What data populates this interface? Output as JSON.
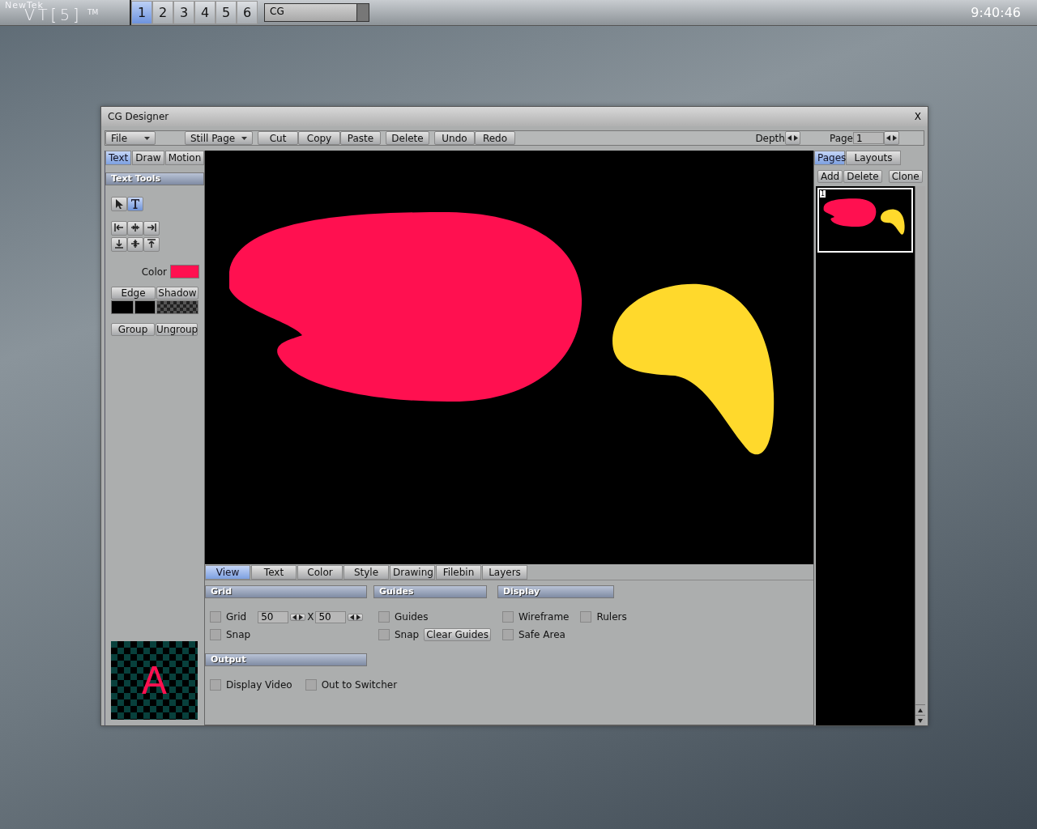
{
  "topbar": {
    "brand": "NewTek",
    "product": "VT[5]",
    "tm": "TM",
    "desktops": [
      {
        "label": "1",
        "selected": true
      },
      {
        "label": "2",
        "selected": false
      },
      {
        "label": "3",
        "selected": false
      },
      {
        "label": "4",
        "selected": false
      },
      {
        "label": "5",
        "selected": false
      },
      {
        "label": "6",
        "selected": false
      }
    ],
    "app_field": "CG",
    "clock": "9:40:46"
  },
  "window": {
    "title": "CG Designer",
    "close": "X"
  },
  "toolbar": {
    "file_menu": "File",
    "page_type": "Still Page",
    "buttons": [
      "Cut",
      "Copy",
      "Paste",
      "Delete",
      "Undo",
      "Redo"
    ],
    "depth_label": "Depth",
    "page_label": "Page",
    "page_value": "1"
  },
  "left_tabs": [
    {
      "label": "Text",
      "selected": true
    },
    {
      "label": "Draw",
      "selected": false
    },
    {
      "label": "Motion",
      "selected": false
    }
  ],
  "text_tools": {
    "header": "Text Tools",
    "tools": [
      {
        "kind": "pointer",
        "selected": false
      },
      {
        "kind": "text",
        "selected": true
      }
    ],
    "color_label": "Color",
    "color": "#ff1050",
    "edge": "Edge",
    "shadow": "Shadow",
    "group": "Group",
    "ungroup": "Ungroup",
    "preview_letter": "A"
  },
  "bottom_tabs": [
    {
      "label": "View",
      "selected": true
    },
    {
      "label": "Text",
      "selected": false
    },
    {
      "label": "Color",
      "selected": false
    },
    {
      "label": "Style",
      "selected": false
    },
    {
      "label": "Drawing",
      "selected": false
    },
    {
      "label": "Filebin",
      "selected": false
    },
    {
      "label": "Layers",
      "selected": false
    }
  ],
  "view": {
    "grid": {
      "title": "Grid",
      "grid": {
        "label": "Grid",
        "checked": false
      },
      "snap": {
        "label": "Snap",
        "checked": false
      },
      "x_value": "50",
      "times": "X",
      "y_value": "50"
    },
    "guides": {
      "title": "Guides",
      "guides": {
        "label": "Guides",
        "checked": false
      },
      "snap": {
        "label": "Snap",
        "checked": false
      },
      "clear": "Clear Guides"
    },
    "display": {
      "title": "Display",
      "wireframe": {
        "label": "Wireframe",
        "checked": false
      },
      "rulers": {
        "label": "Rulers",
        "checked": false
      },
      "safe_area": {
        "label": "Safe Area",
        "checked": false
      }
    },
    "output": {
      "title": "Output",
      "display_video": {
        "label": "Display Video",
        "checked": false
      },
      "out_to_switcher": {
        "label": "Out to Switcher",
        "checked": false
      }
    }
  },
  "right": {
    "tabs": [
      {
        "label": "Pages",
        "selected": true
      },
      {
        "label": "Layouts",
        "selected": false
      }
    ],
    "buttons": [
      "Add",
      "Delete",
      "Clone"
    ],
    "thumbnail_number": "1"
  }
}
